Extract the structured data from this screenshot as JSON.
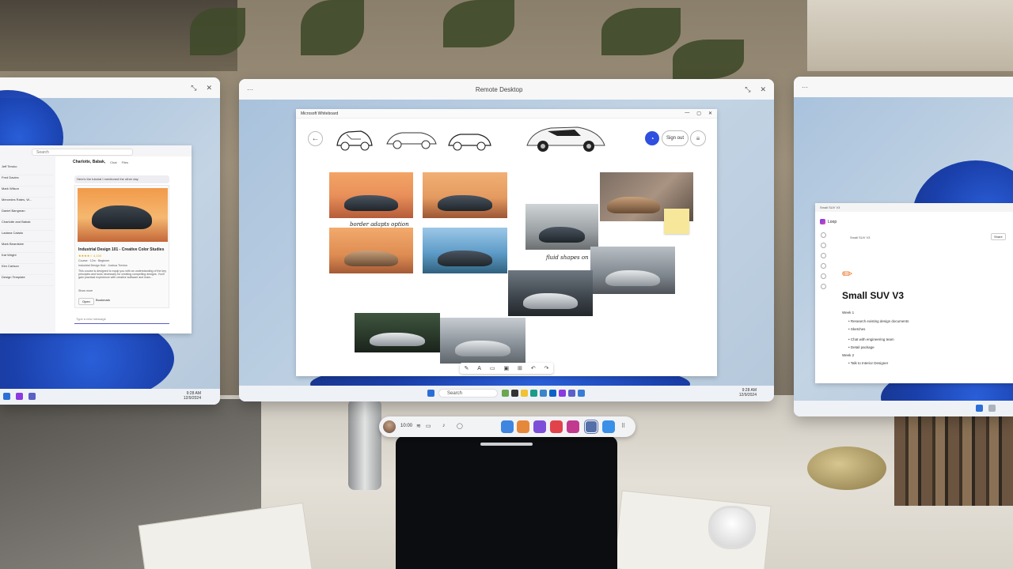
{
  "center_window": {
    "title": "Remote Desktop",
    "whiteboard": {
      "app_title": "Microsoft Whiteboard",
      "sign_out_label": "Sign out",
      "captions": [
        "border adapts option",
        "fluid shapes on"
      ]
    },
    "taskbar": {
      "search_placeholder": "Search",
      "time": "9:28 AM",
      "date": "12/9/2024"
    }
  },
  "left_window": {
    "teams": {
      "search_placeholder": "Search",
      "chat_header": "Charlotte, Babak,",
      "chat_header_tabs": [
        "Chat",
        "Files"
      ],
      "bubble_text": "Here's the tutorial I mentioned the other day",
      "course": {
        "title": "Industrial Design 101 - Creative Color Studies",
        "rating_stars": "★★★★☆ 4,100",
        "meta_1": "Course · 12m · Beginner",
        "meta_2": "Industrial Design Hub · Joshua Trevino",
        "desc": "This course is designed to equip you with an understanding of the key principles and tools necessary for creating compelling designs. You'll gain practical experience with creative software and learn...",
        "show_more": "Show more",
        "open_label": "Open",
        "bookmark_label": "Bookmark"
      },
      "compose_placeholder": "Type a new message",
      "chats": [
        "Jeff Teruko",
        "Fred Davies",
        "Mark Wilson",
        "Mercedes Rates, W...",
        "Daniel Bangman",
        "Charlotte and Babak",
        "Ladana Calado",
        "Mark Beardslee",
        "Kat Wright",
        "Kim Carlson",
        "Design Template"
      ]
    },
    "taskbar": {
      "time": "9:28 AM",
      "date": "12/9/2024"
    }
  },
  "right_window": {
    "loop": {
      "window_title": "Small SUV V3",
      "app_name": "Loop",
      "breadcrumb": "Small SUV V3",
      "share_label": "Share",
      "doc_title": "Small SUV V3",
      "week1": "Week 1",
      "tasks_week1": [
        "Research existing design documents",
        "Sketches",
        "Chat with engineering team",
        "Detail package"
      ],
      "week2": "Week 2",
      "tasks_week2": [
        "Talk to Interior Designer"
      ]
    }
  },
  "dock": {
    "time": "10:00"
  }
}
